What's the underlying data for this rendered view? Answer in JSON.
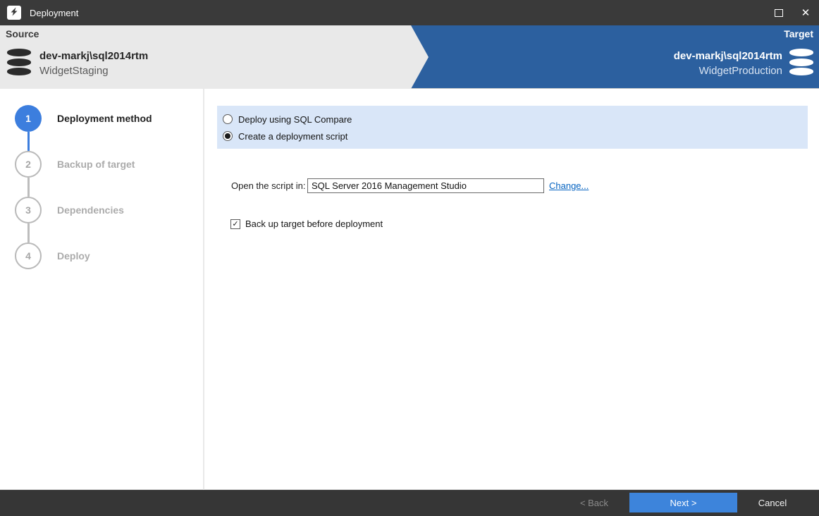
{
  "window": {
    "title": "Deployment"
  },
  "header": {
    "source": {
      "label": "Source",
      "server": "dev-markj\\sql2014rtm",
      "database": "WidgetStaging"
    },
    "target": {
      "label": "Target",
      "server": "dev-markj\\sql2014rtm",
      "database": "WidgetProduction"
    }
  },
  "steps": [
    {
      "number": "1",
      "label": "Deployment method",
      "state": "active"
    },
    {
      "number": "2",
      "label": "Backup of target",
      "state": "inactive"
    },
    {
      "number": "3",
      "label": "Dependencies",
      "state": "inactive"
    },
    {
      "number": "4",
      "label": "Deploy",
      "state": "inactive"
    }
  ],
  "main": {
    "radio_options": [
      {
        "label": "Deploy using SQL Compare",
        "selected": false
      },
      {
        "label": "Create a deployment script",
        "selected": true
      }
    ],
    "open_script_label": "Open the script in:",
    "open_script_value": "SQL Server 2016 Management Studio",
    "change_link": "Change...",
    "backup_checkbox_label": "Back up target before deployment",
    "backup_checked": true,
    "checkmark_glyph": "✓"
  },
  "footer": {
    "back_label": "< Back",
    "next_label": "Next >",
    "cancel_label": "Cancel"
  },
  "colors": {
    "titlebar_bg": "#3a3a3a",
    "header_blue": "#2c609f",
    "header_gray": "#e9e9e9",
    "accent_blue": "#3c7ede",
    "panel_blue": "#d9e6f8",
    "link_blue": "#0563c1",
    "next_button_blue": "#3d84db",
    "footer_bg": "#363636"
  }
}
